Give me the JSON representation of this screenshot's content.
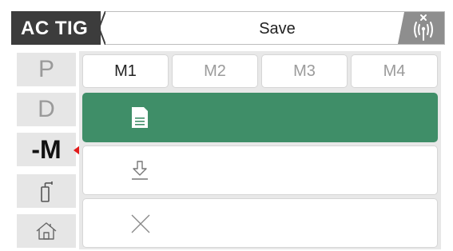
{
  "header": {
    "mode": "AC TIG",
    "title": "Save",
    "status_icon": "wireless-signal-off-icon"
  },
  "sidebar": {
    "items": [
      {
        "label": "P",
        "icon": null,
        "active": false
      },
      {
        "label": "D",
        "icon": null,
        "active": false
      },
      {
        "label": "-M",
        "icon": null,
        "active": true
      },
      {
        "label": "",
        "icon": "gas-cylinder-icon",
        "active": false
      },
      {
        "label": "",
        "icon": "home-icon",
        "active": false
      }
    ],
    "selected_indicator_color": "#e21b1b"
  },
  "memory_tabs": [
    {
      "label": "M1",
      "active": true
    },
    {
      "label": "M2",
      "active": false
    },
    {
      "label": "M3",
      "active": false
    },
    {
      "label": "M4",
      "active": false
    }
  ],
  "actions": [
    {
      "icon": "save-icon",
      "active": true
    },
    {
      "icon": "load-icon",
      "active": false
    },
    {
      "icon": "cancel-icon",
      "active": false
    }
  ],
  "colors": {
    "accent": "#3f8e68",
    "header_dark": "#3c3c3c",
    "pointer": "#e21b1b"
  }
}
